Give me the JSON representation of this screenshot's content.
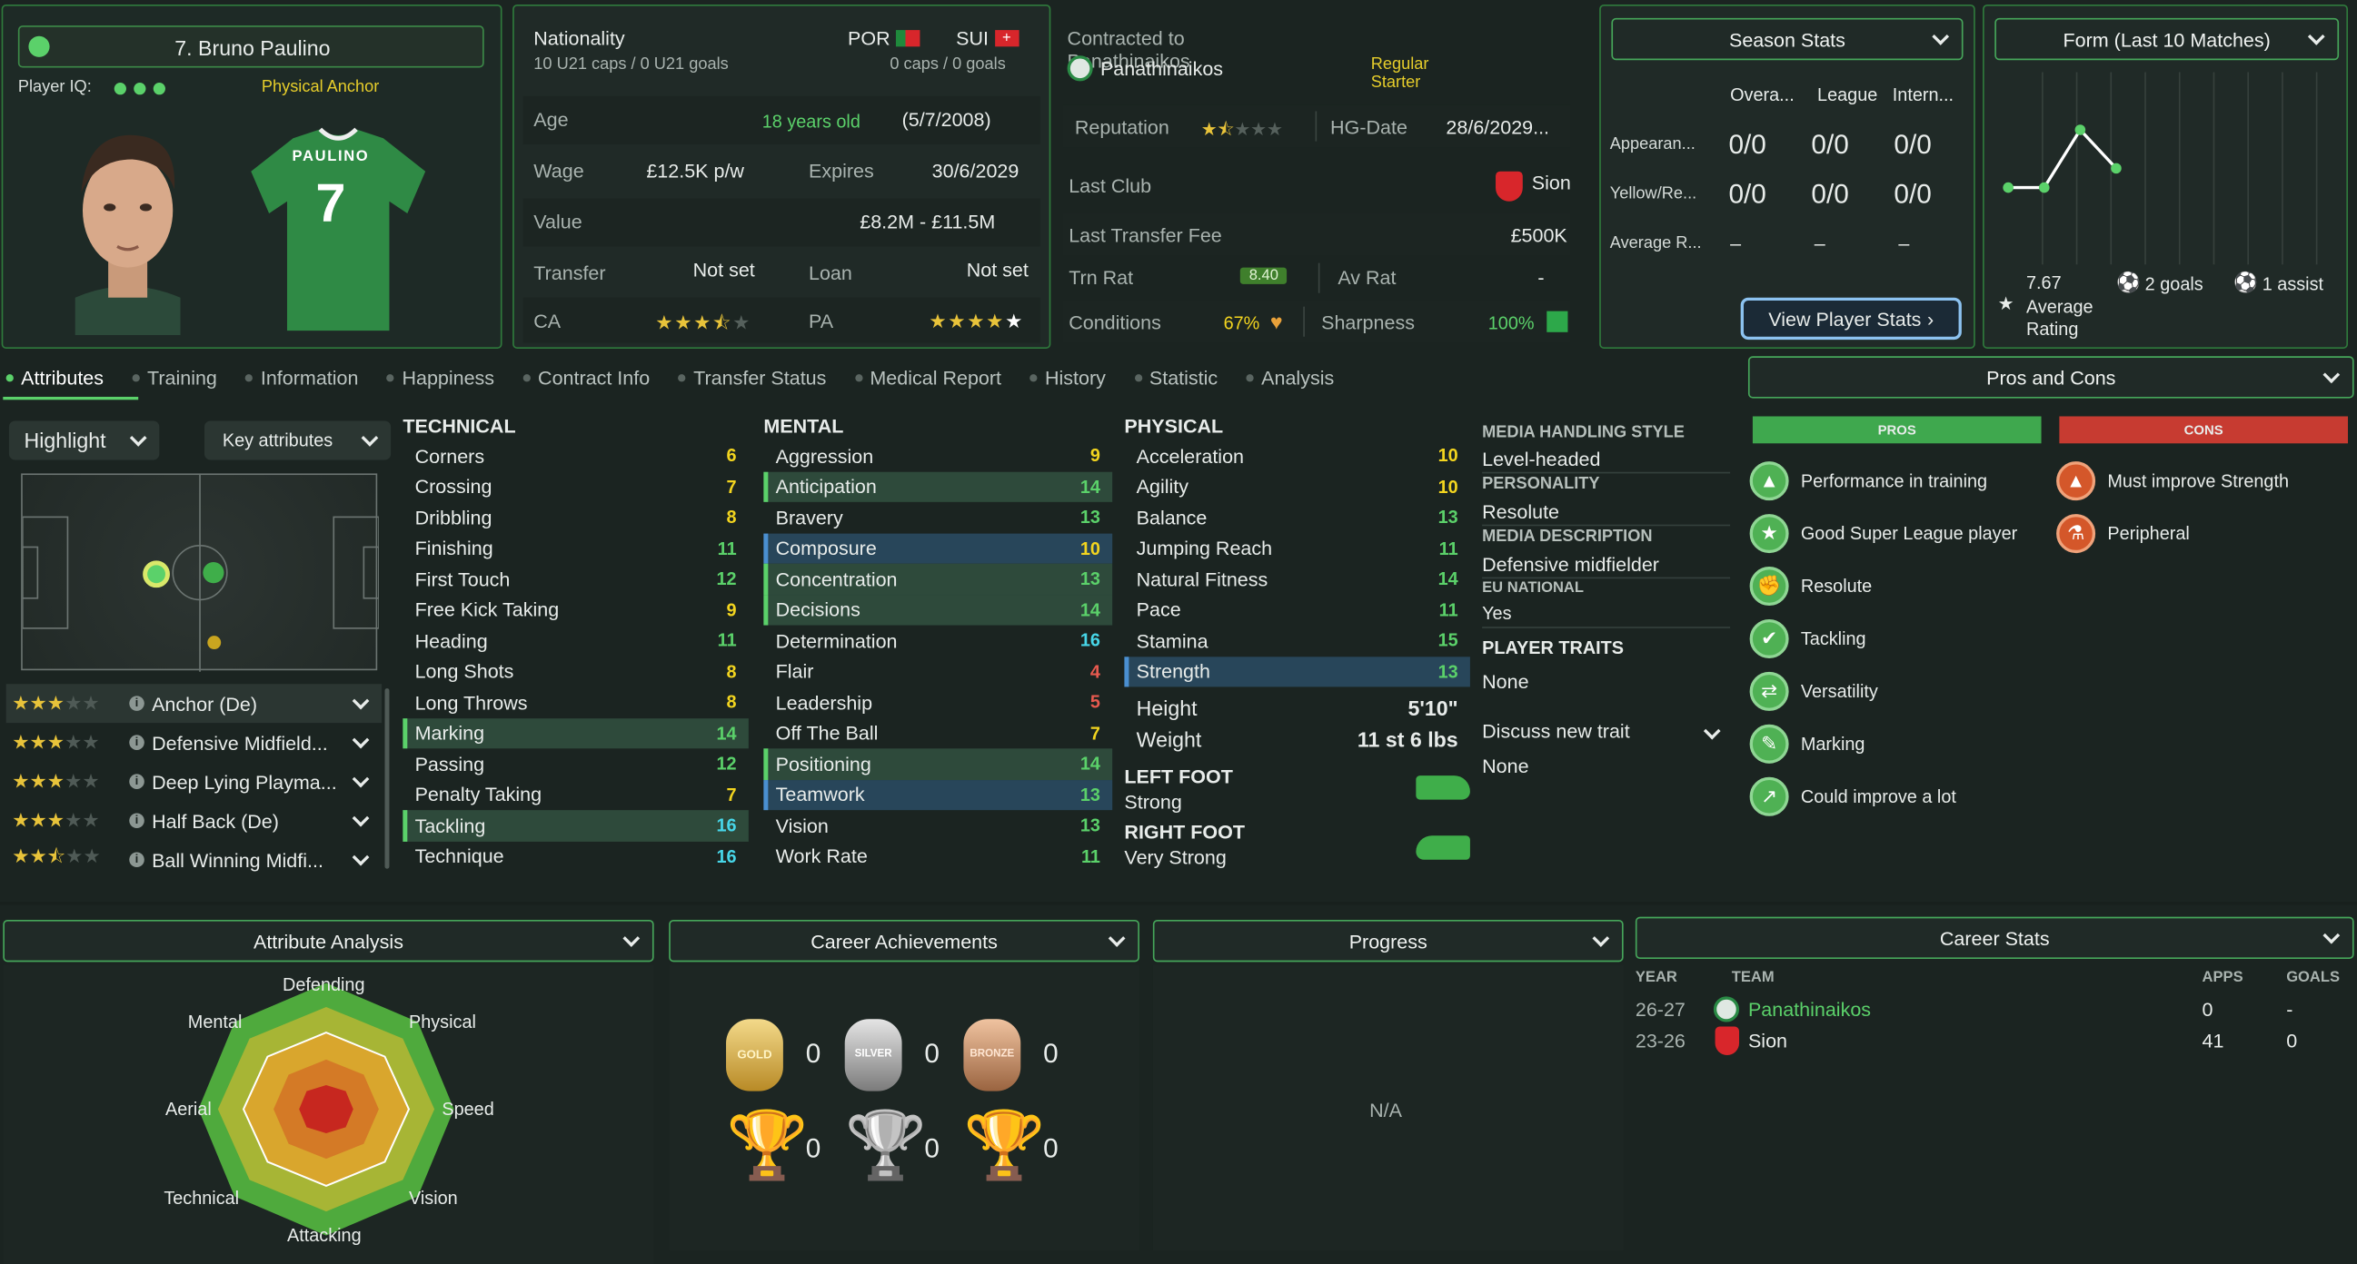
{
  "player": {
    "name": "7. Bruno Paulino",
    "iq_label": "Player IQ:",
    "role": "Physical Anchor",
    "shirt_name": "PAULINO",
    "shirt_number": "7"
  },
  "info": {
    "nationality_label": "Nationality",
    "nat1": "POR",
    "nat2": "SUI",
    "caps1": "10 U21 caps / 0 U21 goals",
    "caps2": "0 caps / 0 goals",
    "age_label": "Age",
    "age_value": "18 years old",
    "dob": "(5/7/2008)",
    "wage_label": "Wage",
    "wage_value": "£12.5K p/w",
    "expires_label": "Expires",
    "expires_value": "30/6/2029",
    "value_label": "Value",
    "value_value": "£8.2M - £11.5M",
    "transfer_label": "Transfer",
    "transfer_value": "Not set",
    "loan_label": "Loan",
    "loan_value": "Not set",
    "ca_label": "CA",
    "pa_label": "PA"
  },
  "contract": {
    "contracted_label": "Contracted to Panathinaikos",
    "club": "Panathinaikos",
    "status": "Regular Starter",
    "reputation_label": "Reputation",
    "hg_label": "HG-Date",
    "hg_value": "28/6/2029...",
    "last_club_label": "Last Club",
    "last_club": "Sion",
    "fee_label": "Last Transfer Fee",
    "fee_value": "£500K",
    "trn_label": "Trn Rat",
    "trn_value": "8.40",
    "av_label": "Av Rat",
    "av_value": "-",
    "cond_label": "Conditions",
    "cond_value": "67%",
    "sharp_label": "Sharpness",
    "sharp_value": "100%"
  },
  "season": {
    "title": "Season Stats",
    "cols": [
      "Overa...",
      "League",
      "Intern..."
    ],
    "rows": [
      {
        "label": "Appearan...",
        "v": [
          "0/0",
          "0/0",
          "0/0"
        ]
      },
      {
        "label": "Yellow/Re...",
        "v": [
          "0/0",
          "0/0",
          "0/0"
        ]
      },
      {
        "label": "Average R...",
        "v": [
          "–",
          "–",
          "–"
        ]
      }
    ],
    "button": "View Player Stats"
  },
  "form": {
    "title": "Form (Last 10 Matches)",
    "avg_value": "7.67",
    "avg_label1": "Average",
    "avg_label2": "Rating",
    "goals": "2 goals",
    "assists": "1 assist",
    "points": [
      7.2,
      7.2,
      8.1,
      7.5
    ]
  },
  "tabs": [
    "Attributes",
    "Training",
    "Information",
    "Happiness",
    "Contract Info",
    "Transfer Status",
    "Medical Report",
    "History",
    "Statistic",
    "Analysis"
  ],
  "controls": {
    "highlight": "Highlight",
    "key": "Key attributes"
  },
  "positions": [
    {
      "name": "Anchor (De)",
      "stars": 3
    },
    {
      "name": "Defensive Midfield...",
      "stars": 3
    },
    {
      "name": "Deep Lying Playma...",
      "stars": 3
    },
    {
      "name": "Half Back (De)",
      "stars": 3
    },
    {
      "name": "Ball Winning Midfi...",
      "stars": 2.5
    }
  ],
  "technical": {
    "title": "TECHNICAL",
    "items": [
      {
        "n": "Corners",
        "v": "6",
        "c": "yellow",
        "h": ""
      },
      {
        "n": "Crossing",
        "v": "7",
        "c": "yellow",
        "h": ""
      },
      {
        "n": "Dribbling",
        "v": "8",
        "c": "yellow",
        "h": ""
      },
      {
        "n": "Finishing",
        "v": "11",
        "c": "green",
        "h": ""
      },
      {
        "n": "First Touch",
        "v": "12",
        "c": "green",
        "h": ""
      },
      {
        "n": "Free Kick Taking",
        "v": "9",
        "c": "yellow",
        "h": ""
      },
      {
        "n": "Heading",
        "v": "11",
        "c": "green",
        "h": ""
      },
      {
        "n": "Long Shots",
        "v": "8",
        "c": "yellow",
        "h": ""
      },
      {
        "n": "Long Throws",
        "v": "8",
        "c": "yellow",
        "h": ""
      },
      {
        "n": "Marking",
        "v": "14",
        "c": "green",
        "h": "hl"
      },
      {
        "n": "Passing",
        "v": "12",
        "c": "green",
        "h": ""
      },
      {
        "n": "Penalty Taking",
        "v": "7",
        "c": "yellow",
        "h": ""
      },
      {
        "n": "Tackling",
        "v": "16",
        "c": "cyan",
        "h": "hl"
      },
      {
        "n": "Technique",
        "v": "16",
        "c": "cyan",
        "h": ""
      }
    ]
  },
  "mental": {
    "title": "MENTAL",
    "items": [
      {
        "n": "Aggression",
        "v": "9",
        "c": "yellow",
        "h": ""
      },
      {
        "n": "Anticipation",
        "v": "14",
        "c": "green",
        "h": "hl"
      },
      {
        "n": "Bravery",
        "v": "13",
        "c": "green",
        "h": ""
      },
      {
        "n": "Composure",
        "v": "10",
        "c": "yellow",
        "h": "key"
      },
      {
        "n": "Concentration",
        "v": "13",
        "c": "green",
        "h": "hl"
      },
      {
        "n": "Decisions",
        "v": "14",
        "c": "green",
        "h": "hl"
      },
      {
        "n": "Determination",
        "v": "16",
        "c": "cyan",
        "h": ""
      },
      {
        "n": "Flair",
        "v": "4",
        "c": "red",
        "h": ""
      },
      {
        "n": "Leadership",
        "v": "5",
        "c": "red",
        "h": ""
      },
      {
        "n": "Off The Ball",
        "v": "7",
        "c": "yellow",
        "h": ""
      },
      {
        "n": "Positioning",
        "v": "14",
        "c": "green",
        "h": "hl"
      },
      {
        "n": "Teamwork",
        "v": "13",
        "c": "green",
        "h": "key"
      },
      {
        "n": "Vision",
        "v": "13",
        "c": "green",
        "h": ""
      },
      {
        "n": "Work Rate",
        "v": "11",
        "c": "green",
        "h": ""
      }
    ]
  },
  "physical": {
    "title": "PHYSICAL",
    "items": [
      {
        "n": "Acceleration",
        "v": "10",
        "c": "yellow",
        "h": ""
      },
      {
        "n": "Agility",
        "v": "10",
        "c": "yellow",
        "h": ""
      },
      {
        "n": "Balance",
        "v": "13",
        "c": "green",
        "h": ""
      },
      {
        "n": "Jumping Reach",
        "v": "11",
        "c": "green",
        "h": ""
      },
      {
        "n": "Natural Fitness",
        "v": "14",
        "c": "green",
        "h": ""
      },
      {
        "n": "Pace",
        "v": "11",
        "c": "green",
        "h": ""
      },
      {
        "n": "Stamina",
        "v": "15",
        "c": "green",
        "h": ""
      },
      {
        "n": "Strength",
        "v": "13",
        "c": "green",
        "h": "key"
      }
    ],
    "height_label": "Height",
    "height_value": "5'10\"",
    "weight_label": "Weight",
    "weight_value": "11 st 6 lbs",
    "left_foot_label": "LEFT FOOT",
    "left_foot_value": "Strong",
    "right_foot_label": "RIGHT FOOT",
    "right_foot_value": "Very Strong"
  },
  "media": {
    "style_label": "MEDIA HANDLING STYLE",
    "style_value": "Level-headed",
    "personality_label": "PERSONALITY",
    "personality_value": "Resolute",
    "desc_label": "MEDIA DESCRIPTION",
    "desc_value": "Defensive midfielder",
    "eu_label": "EU NATIONAL",
    "eu_value": "Yes",
    "traits_label": "PLAYER TRAITS",
    "traits_value": "None",
    "discuss": "Discuss new trait",
    "discuss_value": "None"
  },
  "pros_cons": {
    "title": "Pros and Cons",
    "pros_label": "PROS",
    "cons_label": "CONS",
    "pros": [
      "Performance in training",
      "Good Super League player",
      "Resolute",
      "Tackling",
      "Versatility",
      "Marking",
      "Could improve a lot"
    ],
    "cons": [
      "Must improve Strength",
      "Peripheral"
    ]
  },
  "analysis": {
    "title": "Attribute Analysis",
    "labels": [
      "Defending",
      "Physical",
      "Speed",
      "Vision",
      "Attacking",
      "Technical",
      "Aerial",
      "Mental"
    ]
  },
  "achievements": {
    "title": "Career Achievements",
    "medals": [
      "GOLD",
      "SILVER",
      "BRONZE"
    ],
    "counts": [
      "0",
      "0",
      "0",
      "0",
      "0",
      "0"
    ]
  },
  "progress": {
    "title": "Progress",
    "empty": "N/A"
  },
  "career": {
    "title": "Career Stats",
    "cols": [
      "YEAR",
      "TEAM",
      "APPS",
      "GOALS"
    ],
    "rows": [
      {
        "year": "26-27",
        "team": "Panathinaikos",
        "apps": "0",
        "goals": "-"
      },
      {
        "year": "23-26",
        "team": "Sion",
        "apps": "41",
        "goals": "0"
      }
    ]
  },
  "colors": {
    "accent": "#5bd16a",
    "panel_border": "#2f7a3c",
    "bg": "#1b2421",
    "pros": "#3fa84e",
    "cons": "#c73b31"
  }
}
